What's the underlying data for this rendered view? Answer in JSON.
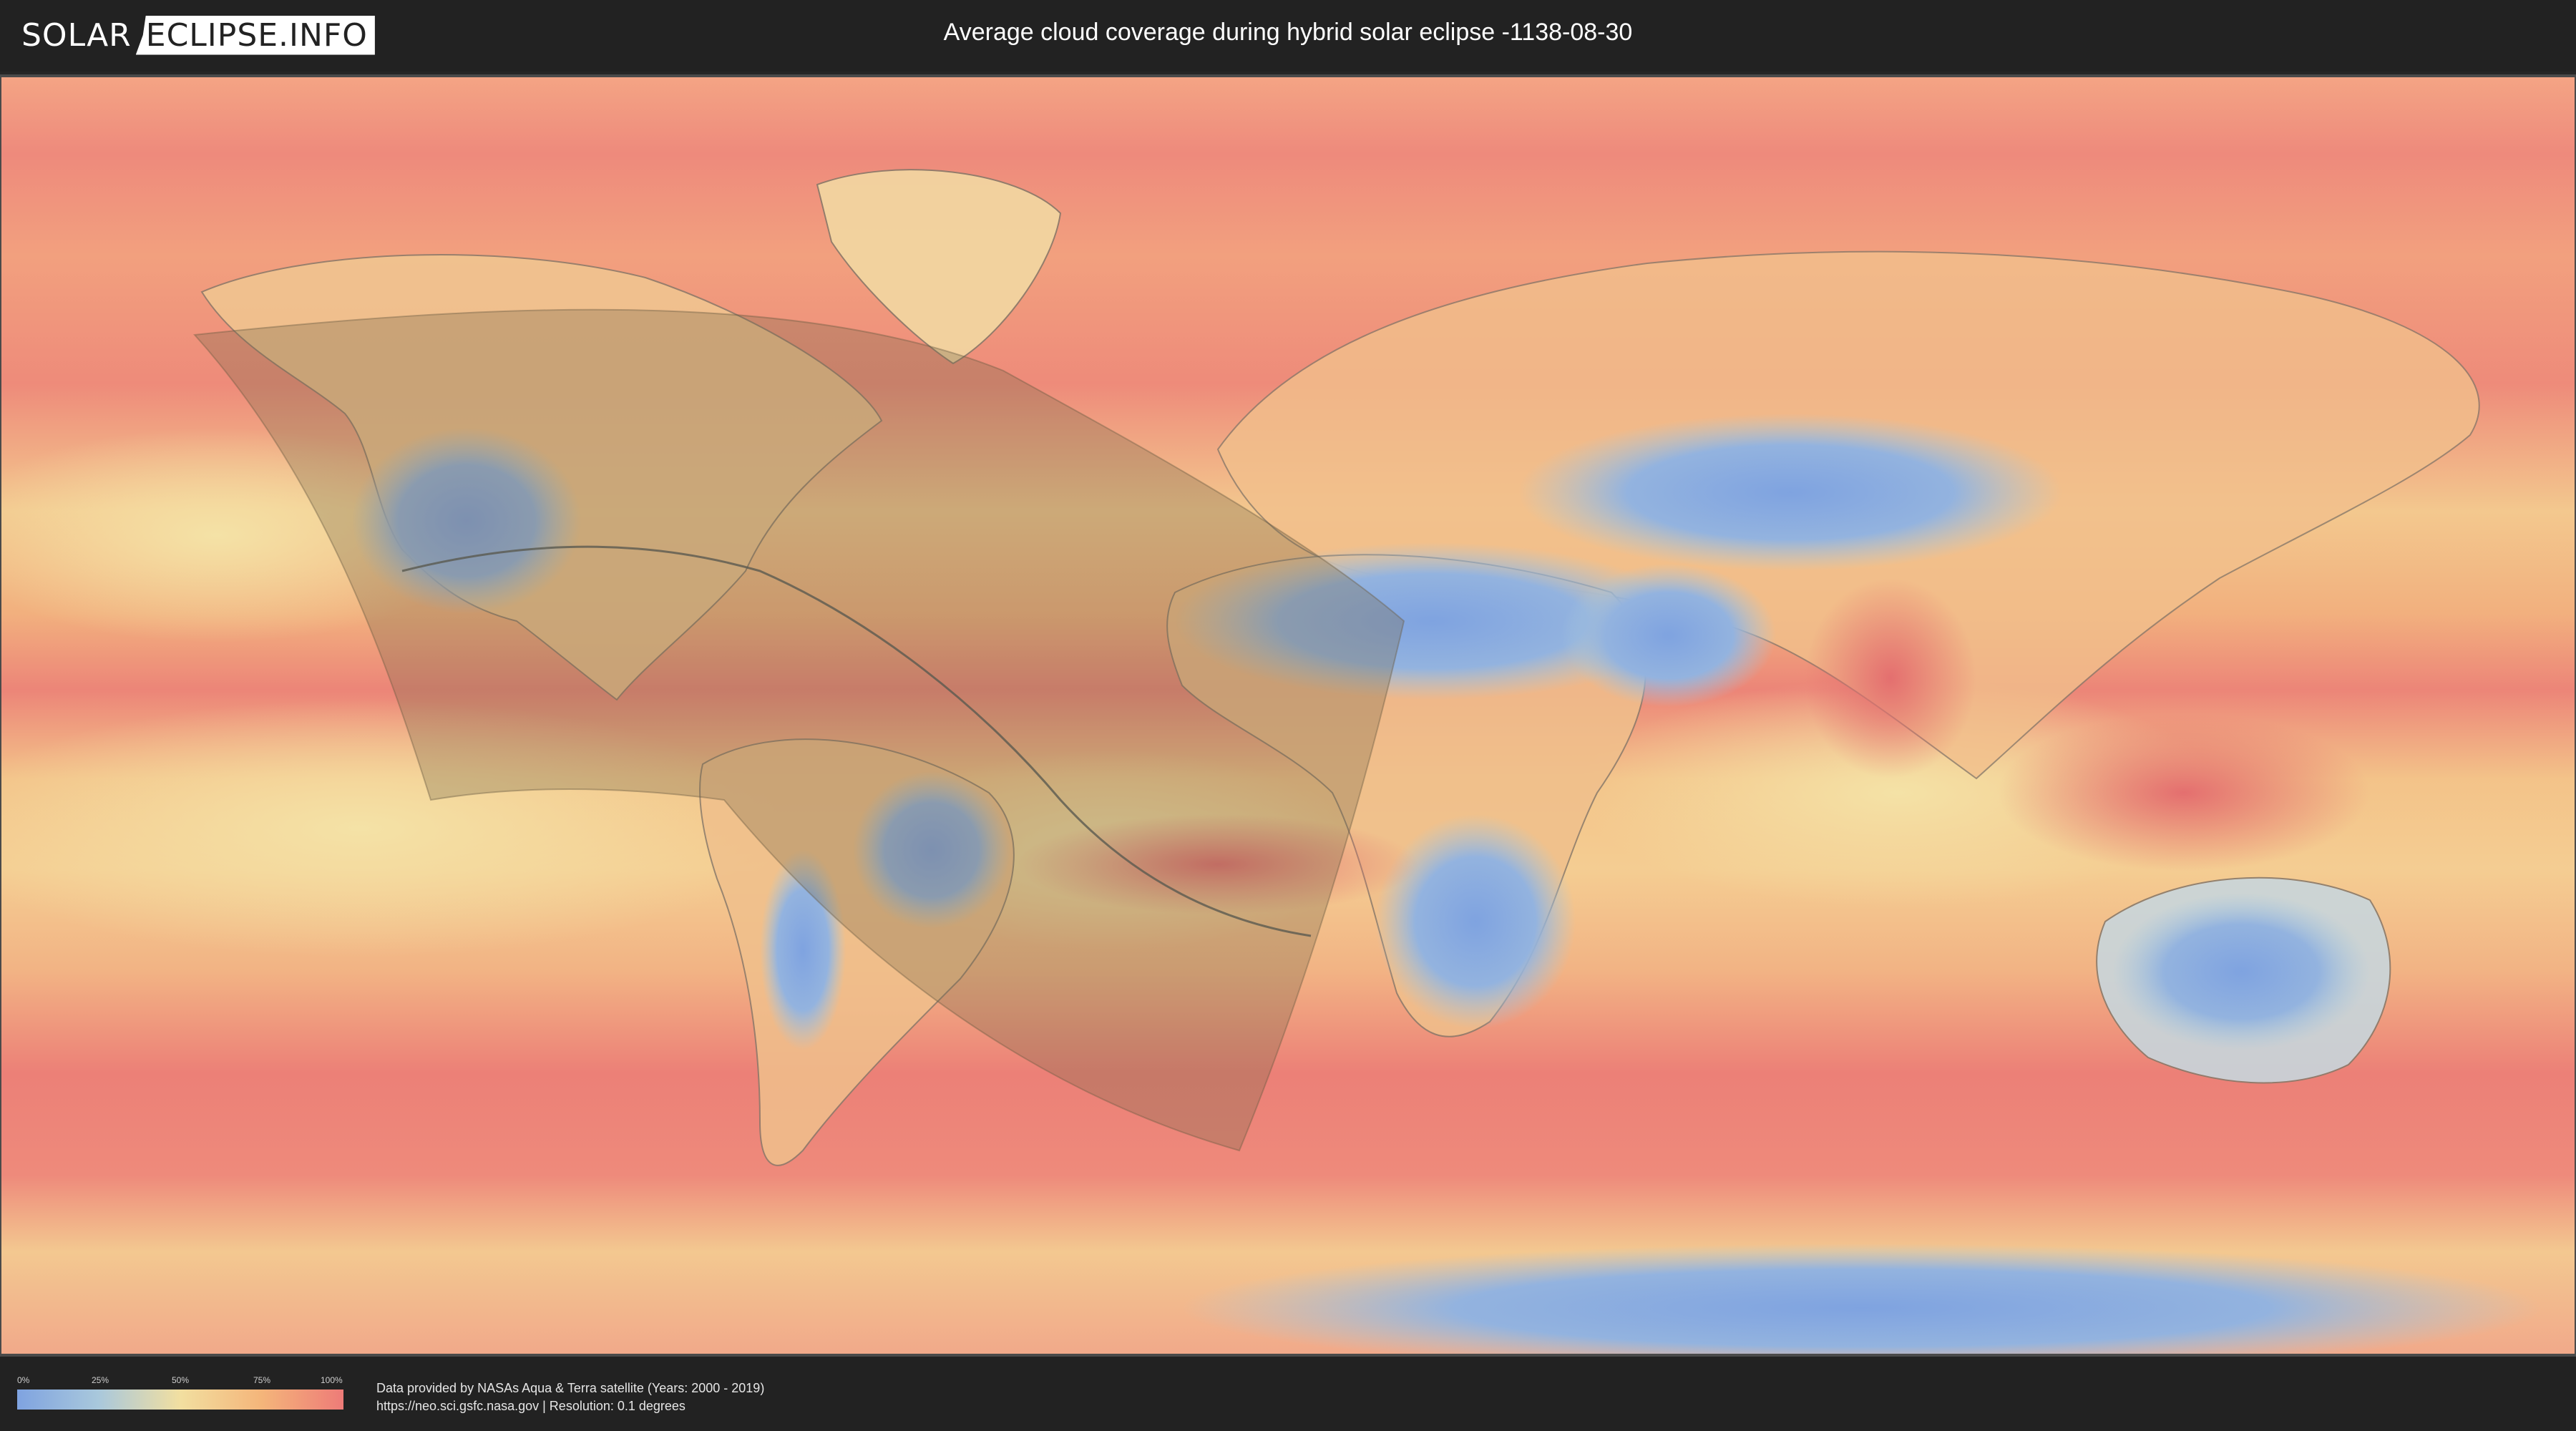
{
  "header": {
    "logo_left": "SOLAR",
    "logo_right": "ECLIPSE.INFO",
    "title": "Average cloud coverage during hybrid solar eclipse -1138-08-30"
  },
  "map": {
    "description": "world cloud coverage map",
    "colors": {
      "low": "#7fa3e0",
      "mid": "#f2dfa0",
      "high": "#ee7b78",
      "eclipse_overlay": "#7a6a4c"
    }
  },
  "legend": {
    "ticks": [
      "0%",
      "25%",
      "50%",
      "75%",
      "100%"
    ]
  },
  "footer": {
    "credit_line1": "Data provided by NASAs Aqua & Terra satellite (Years: 2000 - 2019)",
    "credit_line2": "https://neo.sci.gsfc.nasa.gov | Resolution: 0.1 degrees"
  }
}
